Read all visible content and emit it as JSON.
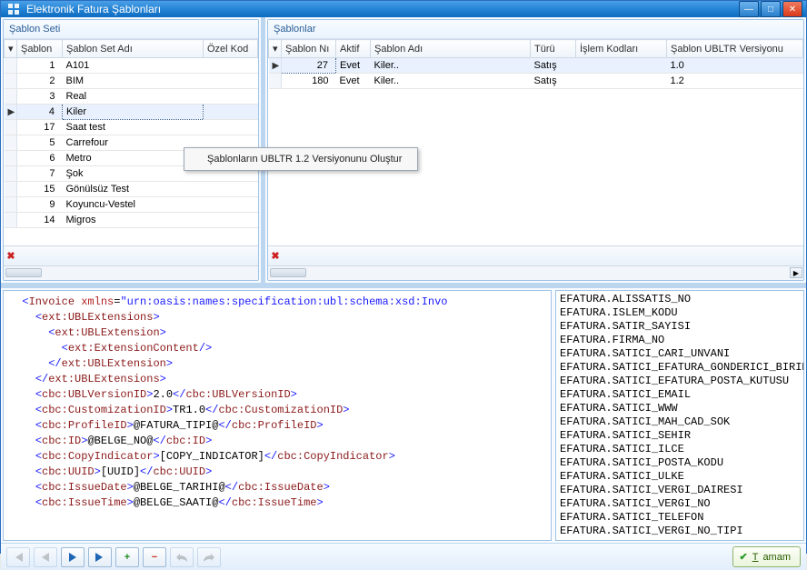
{
  "window": {
    "title": "Elektronik Fatura Şablonları"
  },
  "leftPanel": {
    "title": "Şablon Seti",
    "columns": {
      "indicator": "",
      "c1": "Şablon",
      "c2": "Şablon Set Adı",
      "c3": "Özel Kod"
    },
    "rows": [
      {
        "n": "1",
        "name": "A101"
      },
      {
        "n": "2",
        "name": "BIM"
      },
      {
        "n": "3",
        "name": "Real"
      },
      {
        "n": "4",
        "name": "Kiler",
        "selected": true
      },
      {
        "n": "17",
        "name": "Saat test"
      },
      {
        "n": "5",
        "name": "Carrefour"
      },
      {
        "n": "6",
        "name": "Metro"
      },
      {
        "n": "7",
        "name": "Şok"
      },
      {
        "n": "15",
        "name": "Gönülsüz Test"
      },
      {
        "n": "9",
        "name": "Koyuncu-Vestel"
      },
      {
        "n": "14",
        "name": "Migros"
      }
    ]
  },
  "rightPanel": {
    "title": "Şablonlar",
    "columns": {
      "c1": "Şablon Nı",
      "c2": "Aktif",
      "c3": "Şablon Adı",
      "c4": "Türü",
      "c5": "İşlem Kodları",
      "c6": "Şablon UBLTR Versiyonu"
    },
    "rows": [
      {
        "no": "27",
        "aktif": "Evet",
        "adi": "Kiler..",
        "turu": "Satış",
        "islem": "",
        "ver": "1.0",
        "selected": true
      },
      {
        "no": "180",
        "aktif": "Evet",
        "adi": "Kiler..",
        "turu": "Satış",
        "islem": "",
        "ver": "1.2"
      }
    ]
  },
  "contextMenu": {
    "item1": "Şablonların UBLTR 1.2 Versiyonunu Oluştur"
  },
  "xml": {
    "lines": [
      {
        "indent": 0,
        "open": "Invoice",
        "attrs": [
          [
            "xmlns",
            "urn:oasis:names:specification:ubl:schema:xsd:Invo"
          ]
        ]
      },
      {
        "indent": 1,
        "open": "ext:UBLExtensions"
      },
      {
        "indent": 2,
        "open": "ext:UBLExtension"
      },
      {
        "indent": 3,
        "selfclose": "ext:ExtensionContent"
      },
      {
        "indent": 2,
        "close": "ext:UBLExtension"
      },
      {
        "indent": 1,
        "close": "ext:UBLExtensions"
      },
      {
        "indent": 1,
        "open": "cbc:UBLVersionID",
        "text": "2.0",
        "close": "cbc:UBLVersionID"
      },
      {
        "indent": 1,
        "open": "cbc:CustomizationID",
        "text": "TR1.0",
        "close": "cbc:CustomizationID"
      },
      {
        "indent": 1,
        "open": "cbc:ProfileID",
        "text": "@FATURA_TIPI@",
        "close": "cbc:ProfileID"
      },
      {
        "indent": 1,
        "open": "cbc:ID",
        "text": "@BELGE_NO@",
        "close": "cbc:ID"
      },
      {
        "indent": 1,
        "open": "cbc:CopyIndicator",
        "text": "[COPY_INDICATOR]",
        "close": "cbc:CopyIndicator"
      },
      {
        "indent": 1,
        "open": "cbc:UUID",
        "text": "[UUID]",
        "close": "cbc:UUID"
      },
      {
        "indent": 1,
        "open": "cbc:IssueDate",
        "text": "@BELGE_TARIHI@",
        "close": "cbc:IssueDate"
      },
      {
        "indent": 1,
        "open": "cbc:IssueTime",
        "text": "@BELGE_SAATI@",
        "close": "cbc:IssueTime"
      }
    ]
  },
  "fields": [
    "EFATURA.ALISSATIS_NO",
    "EFATURA.ISLEM_KODU",
    "EFATURA.SATIR_SAYISI",
    "EFATURA.FIRMA_NO",
    "EFATURA.SATICI_CARI_UNVANI",
    "EFATURA.SATICI_EFATURA_GONDERICI_BIRIM",
    "EFATURA.SATICI_EFATURA_POSTA_KUTUSU",
    "EFATURA.SATICI_EMAIL",
    "EFATURA.SATICI_WWW",
    "EFATURA.SATICI_MAH_CAD_SOK",
    "EFATURA.SATICI_SEHIR",
    "EFATURA.SATICI_ILCE",
    "EFATURA.SATICI_POSTA_KODU",
    "EFATURA.SATICI_ULKE",
    "EFATURA.SATICI_VERGI_DAIRESI",
    "EFATURA.SATICI_VERGI_NO",
    "EFATURA.SATICI_TELEFON",
    "EFATURA.SATICI_VERGI_NO_TIPI"
  ],
  "toolbar": {
    "ok": "Tamam"
  }
}
